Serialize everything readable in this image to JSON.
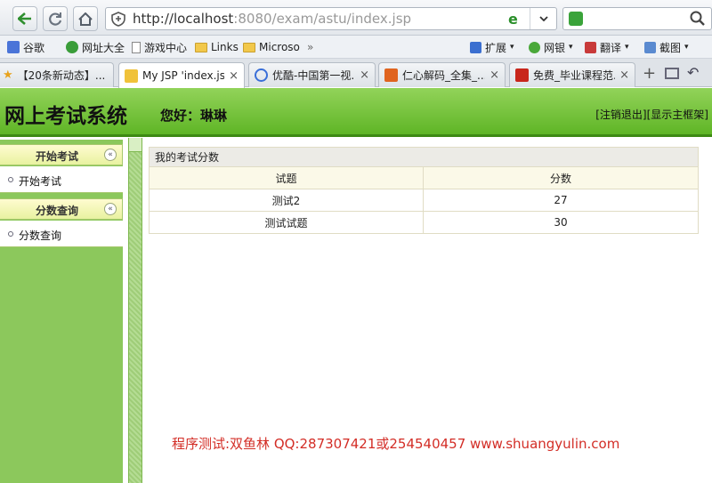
{
  "browser": {
    "url_host": "http://localhost",
    "url_rest": ":8080/exam/astu/index.jsp",
    "bookmarks": [
      "谷歌",
      "网址大全",
      "游戏中心",
      "Links",
      "Microso",
      "»"
    ],
    "bookmark_tools": [
      "扩展",
      "网银",
      "翻译",
      "截图"
    ],
    "tabs": [
      {
        "label": "【20条新动态】..."
      },
      {
        "label": "My JSP 'index.js..."
      },
      {
        "label": "优酷-中国第一视..."
      },
      {
        "label": "仁心解码_全集_..."
      },
      {
        "label": "免费_毕业课程范..."
      }
    ],
    "tab_close": "×",
    "new_tab": "+"
  },
  "header": {
    "title": "网上考试系统",
    "greeting": "您好：琳琳",
    "logout_link": "[注销退出]",
    "frame_link": "[显示主框架]"
  },
  "sidebar": {
    "sections": [
      {
        "title": "开始考试",
        "item": "开始考试"
      },
      {
        "title": "分数查询",
        "item": "分数查询"
      }
    ],
    "collapse_glyph": "«"
  },
  "scores": {
    "caption": "我的考试分数",
    "columns": [
      "试题",
      "分数"
    ],
    "rows": [
      {
        "exam": "测试2",
        "score": "27"
      },
      {
        "exam": "测试试题",
        "score": "30"
      }
    ]
  },
  "footer_note": "程序测试:双鱼林 QQ:287307421或254540457 www.shuangyulin.com",
  "colors": {
    "header_green": "#6cbf34",
    "sidebar_green": "#8cc85c",
    "note_red": "#d32d26"
  }
}
